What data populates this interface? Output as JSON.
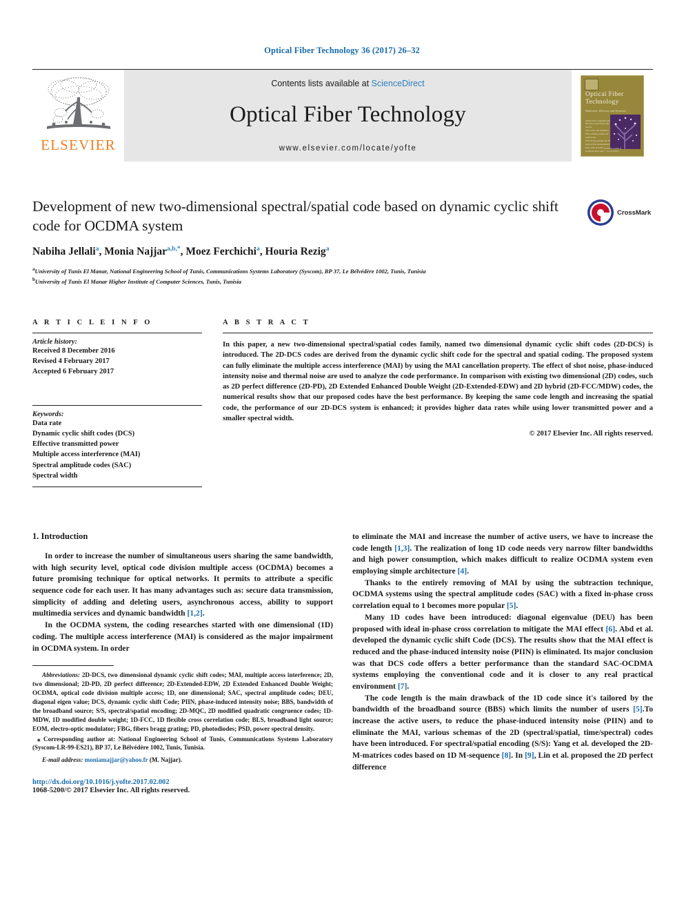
{
  "running_head": "Optical Fiber Technology 36 (2017) 26–32",
  "banner": {
    "publisher_name": "ELSEVIER",
    "publisher_logo_icon": "elsevier-tree-icon",
    "contents_prefix": "Contents lists available at ",
    "sciencedirect": "ScienceDirect",
    "journal_title": "Optical Fiber Technology",
    "journal_url": "www.elsevier.com/locate/yofte",
    "cover": {
      "title_line1": "Optical  Fiber",
      "title_line2": "Technology",
      "subtitle": "Materials, Devices and Systems",
      "toc_lines": "Optical fiber communications\nPhotonic crystal fibers and devices\nFiber lasers and amplifiers\nFiber sensing systems and applications\nFiber Bragg gratings and filters\nOptical fiber measurements\nFiber optic networks\nNonlinear fiber optics",
      "footer": "Available online at\nScienceDirect"
    }
  },
  "article": {
    "title": "Development of new two-dimensional spectral/spatial code based on dynamic cyclic shift code for OCDMA system",
    "crossmark_label": "CrossMark",
    "authors": [
      {
        "name": "Nabiha Jellali",
        "sup": "a"
      },
      {
        "name": "Monia Najjar",
        "sup": "a,b,*"
      },
      {
        "name": "Moez Ferchichi",
        "sup": "a"
      },
      {
        "name": "Houria Rezig",
        "sup": "a"
      }
    ],
    "affiliations": [
      {
        "sup": "a",
        "text": "University of Tunis El Manar, National Engineering School of Tunis, Communications Systems Laboratory (Syscom), BP 37, Le Bélvédère 1002, Tunis, Tunisia"
      },
      {
        "sup": "b",
        "text": "University of Tunis El Manar Higher Institute of Computer Sciences, Tunis, Tunisia"
      }
    ]
  },
  "article_info": {
    "heading": "A R T I C L E    I N F O",
    "history_label": "Article history:",
    "history": [
      "Received 8 December 2016",
      "Revised 4 February 2017",
      "Accepted 6 February 2017"
    ],
    "keywords_label": "Keywords:",
    "keywords": [
      "Data rate",
      "Dynamic cyclic shift codes (DCS)",
      "Effective transmitted power",
      "Multiple access interference (MAI)",
      "Spectral amplitude codes (SAC)",
      "Spectral width"
    ]
  },
  "abstract": {
    "heading": "A B S T R A C T",
    "text": "In this paper, a new two-dimensional spectral/spatial codes family, named two dimensional dynamic cyclic shift codes (2D-DCS) is introduced. The 2D-DCS codes are derived from the dynamic cyclic shift code for the spectral and spatial coding. The proposed system can fully eliminate the multiple access interference (MAI) by using the MAI cancellation property. The effect of shot noise, phase-induced intensity noise and thermal noise are used to analyze the code performance. In comparison with existing two dimensional (2D) codes, such as 2D perfect difference (2D-PD), 2D Extended Enhanced Double Weight (2D-Extended-EDW) and 2D hybrid (2D-FCC/MDW) codes, the numerical results show that our proposed codes have the best performance. By keeping the same code length and increasing the spatial code, the performance of our 2D-DCS system is enhanced; it provides higher data rates while using lower transmitted power and a smaller spectral width.",
    "copyright": "© 2017 Elsevier Inc. All rights reserved."
  },
  "body": {
    "section_heading": "1. Introduction",
    "left_paragraphs": [
      "In order to increase the number of simultaneous users sharing the same bandwidth, with high security level, optical code division multiple access (OCDMA) becomes a future promising technique for optical networks. It permits to attribute a specific sequence code for each user. It has many advantages such as: secure data transmission, simplicity of adding and deleting users, asynchronous access, ability to support multimedia services and dynamic bandwidth ",
      "In the OCDMA system, the coding researches started with one dimensional (1D) coding. The multiple access interference (MAI) is considered as the major impairment in OCDMA system. In order"
    ],
    "left_p1_ref": "[1,2]",
    "right_paragraphs": [
      "to eliminate the MAI and increase the number of active users, we have to increase the code length ",
      "Thanks to the entirely removing of MAI by using the subtraction technique, OCDMA systems using the spectral amplitude codes (SAC) with a fixed in-phase cross correlation equal to 1 becomes more popular ",
      "Many 1D codes have been introduced: diagonal eigenvalue (DEU) has been proposed with ideal in-phase cross correlation to mitigate the MAI effect ",
      "The code length is the main drawback of the 1D code since it's tailored by the bandwidth of the broadband source (BBS) which limits the number of users "
    ],
    "right_p1_tail": ". The realization of long 1D code needs very narrow filter bandwidths and high power consumption, which makes difficult to realize OCDMA system even employing simple architecture ",
    "right_p3_tail": ". Abd et al. developed the dynamic cyclic shift Code (DCS). The results show that the MAI effect is reduced and the phase-induced intensity noise (PIIN) is eliminated. Its major conclusion was that DCS code offers a better performance than the standard SAC-OCDMA systems employing the conventional code and it is closer to any real practical environment ",
    "right_p4_tail": ".To increase the active users, to reduce the phase-induced intensity noise (PIIN) and to eliminate the MAI, various schemas of the 2D (spectral/spatial, time/spectral) codes have been introduced. For spectral/spatial encoding (S/S): Yang et al. developed the 2D-M-matrices codes based on 1D M-sequence ",
    "right_p4_tail2": ". In ",
    "right_p4_tail3": ", Lin et al. proposed the 2D perfect difference",
    "refs": {
      "r13": "[1,3]",
      "r4": "[4]",
      "r5": "[5]",
      "r6": "[6]",
      "r7": "[7]",
      "r5b": "[5]",
      "r8": "[8]",
      "r9": "[9]"
    }
  },
  "footnotes": {
    "abbrev_label": "Abbreviations:",
    "abbrev_text": " 2D-DCS, two dimensional dynamic cyclic shift codes; MAI, multiple access interference; 2D, two dimensional; 2D-PD, 2D perfect difference; 2D-Extended-EDW, 2D Extended Enhanced Double Weight; OCDMA, optical code division multiple access; 1D, one dimensional; SAC, spectral amplitude codes; DEU, diagonal eigen value; DCS, dynamic cyclic shift Code; PIIN, phase-induced intensity noise; BBS, bandwidth of the broadband source; S/S, spectral/spatial encoding; 2D-MQC, 2D modified quadratic congruence codes; 1D-MDW, 1D modified double weight; 1D-FCC, 1D flexible cross correlation code; BLS, broadband light source; EOM, electro-optic modulator; FBG, fibers bragg grating; PD, photodiodes; PSD, power spectral density.",
    "corresponding": "⁎ Corresponding author at: National Engineering School of Tunis, Communications Systems Laboratory (Syscom-LR-99-ES21), BP 37, Le Bélvédère 1002, Tunis, Tunisia.",
    "email_label": "E-mail address:",
    "email": "moniamajjar@yahoo.fr",
    "email_suffix": " (M. Najjar).",
    "doi": "http://dx.doi.org/10.1016/j.yofte.2017.02.002",
    "issn": "1068-5200/© 2017 Elsevier Inc. All rights reserved."
  },
  "colors": {
    "link_blue": "#1a6bab",
    "sciencedirect_blue": "#2a7fbd",
    "elsevier_orange": "#ef7d22",
    "banner_gray": "#e6e6e6",
    "cover_olive": "#96873a"
  }
}
